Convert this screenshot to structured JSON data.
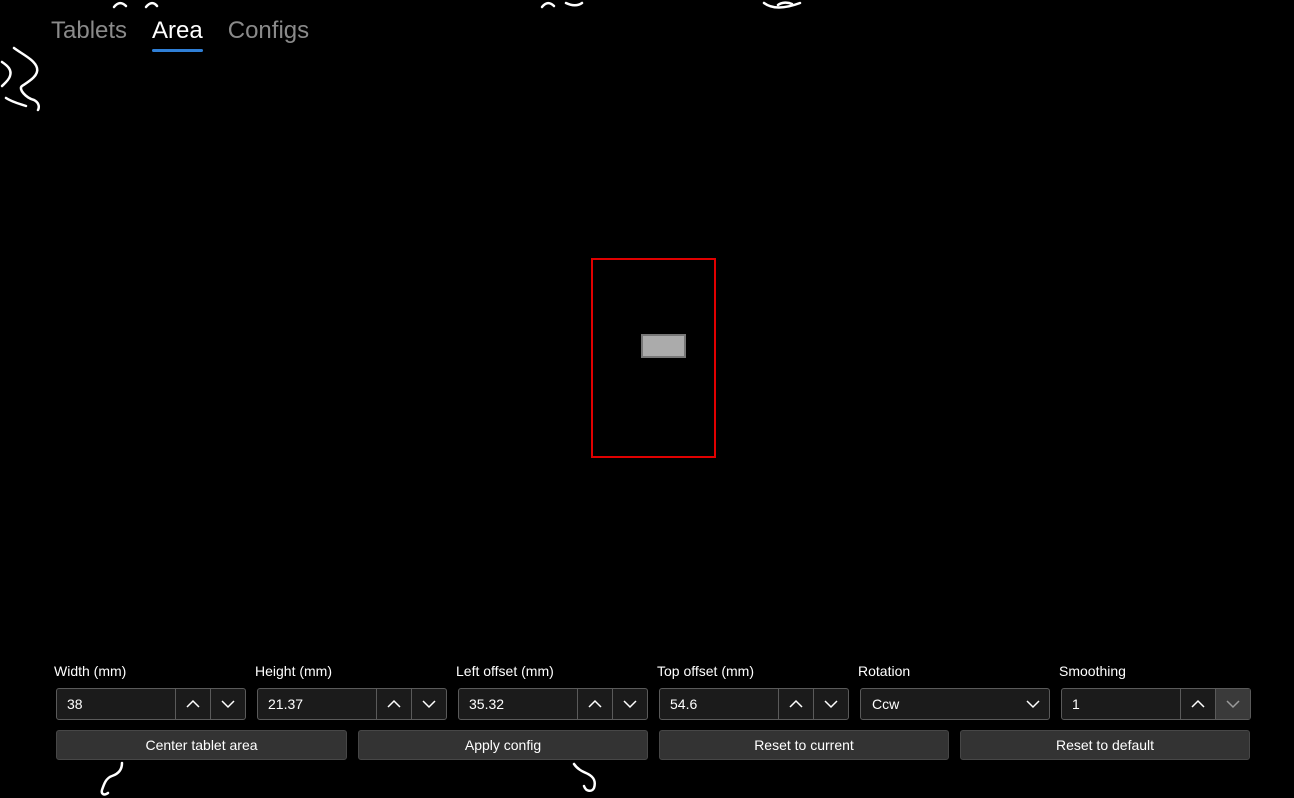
{
  "tabs": [
    {
      "label": "Tablets",
      "active": false
    },
    {
      "label": "Area",
      "active": true
    },
    {
      "label": "Configs",
      "active": false
    }
  ],
  "area_preview": {
    "tablet_area_color": "#e00000",
    "screen_area_color": "#ababab"
  },
  "fields": {
    "width": {
      "label": "Width (mm)",
      "value": "38"
    },
    "height": {
      "label": "Height (mm)",
      "value": "21.37"
    },
    "left_offset": {
      "label": "Left offset (mm)",
      "value": "35.32"
    },
    "top_offset": {
      "label": "Top offset (mm)",
      "value": "54.6"
    },
    "rotation": {
      "label": "Rotation",
      "value": "Ccw"
    },
    "smoothing": {
      "label": "Smoothing",
      "value": "1"
    }
  },
  "buttons": {
    "center": "Center tablet area",
    "apply": "Apply config",
    "reset_current": "Reset to current",
    "reset_default": "Reset to default"
  },
  "colors": {
    "background": "#000000",
    "accent": "#2f7fd6"
  }
}
